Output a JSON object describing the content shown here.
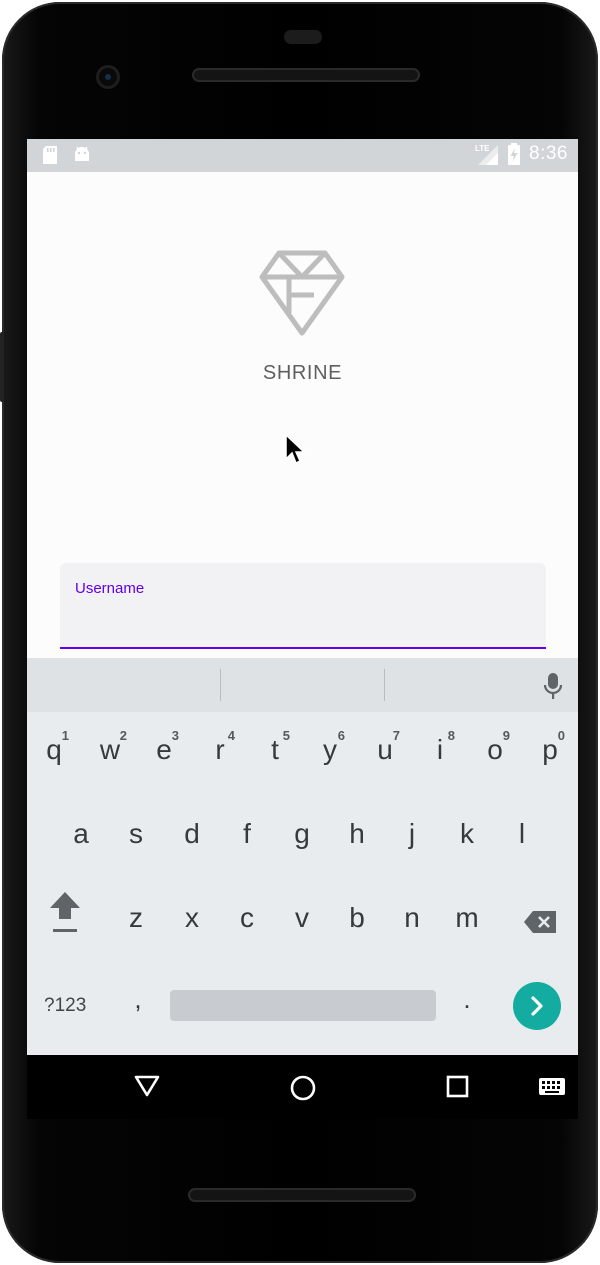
{
  "status_bar": {
    "time": "8:36",
    "network_label": "LTE",
    "left_icons": [
      "sd-card-icon",
      "android-icon"
    ],
    "right_icons": [
      "signal-icon",
      "battery-charging-icon"
    ],
    "background": "#d2d5d8"
  },
  "app": {
    "logo_icon": "diamond-icon",
    "title": "SHRINE",
    "username_field": {
      "label": "Username",
      "value": "",
      "accent_color": "#6200ee"
    }
  },
  "keyboard": {
    "row1": [
      {
        "key": "q",
        "hint": "1"
      },
      {
        "key": "w",
        "hint": "2"
      },
      {
        "key": "e",
        "hint": "3"
      },
      {
        "key": "r",
        "hint": "4"
      },
      {
        "key": "t",
        "hint": "5"
      },
      {
        "key": "y",
        "hint": "6"
      },
      {
        "key": "u",
        "hint": "7"
      },
      {
        "key": "i",
        "hint": "8"
      },
      {
        "key": "o",
        "hint": "9"
      },
      {
        "key": "p",
        "hint": "0"
      }
    ],
    "row2": [
      "a",
      "s",
      "d",
      "f",
      "g",
      "h",
      "j",
      "k",
      "l"
    ],
    "row3": [
      "z",
      "x",
      "c",
      "v",
      "b",
      "n",
      "m"
    ],
    "symbols_label": "?123",
    "comma_label": ",",
    "period_label": ".",
    "enter_color": "#14aca0",
    "icons": [
      "mic-icon",
      "shift-icon",
      "backspace-icon",
      "enter-arrow-icon"
    ]
  },
  "navigation_bar": {
    "icons": [
      "back-triangle-icon",
      "home-circle-icon",
      "recents-square-icon",
      "keyboard-switch-icon"
    ]
  }
}
